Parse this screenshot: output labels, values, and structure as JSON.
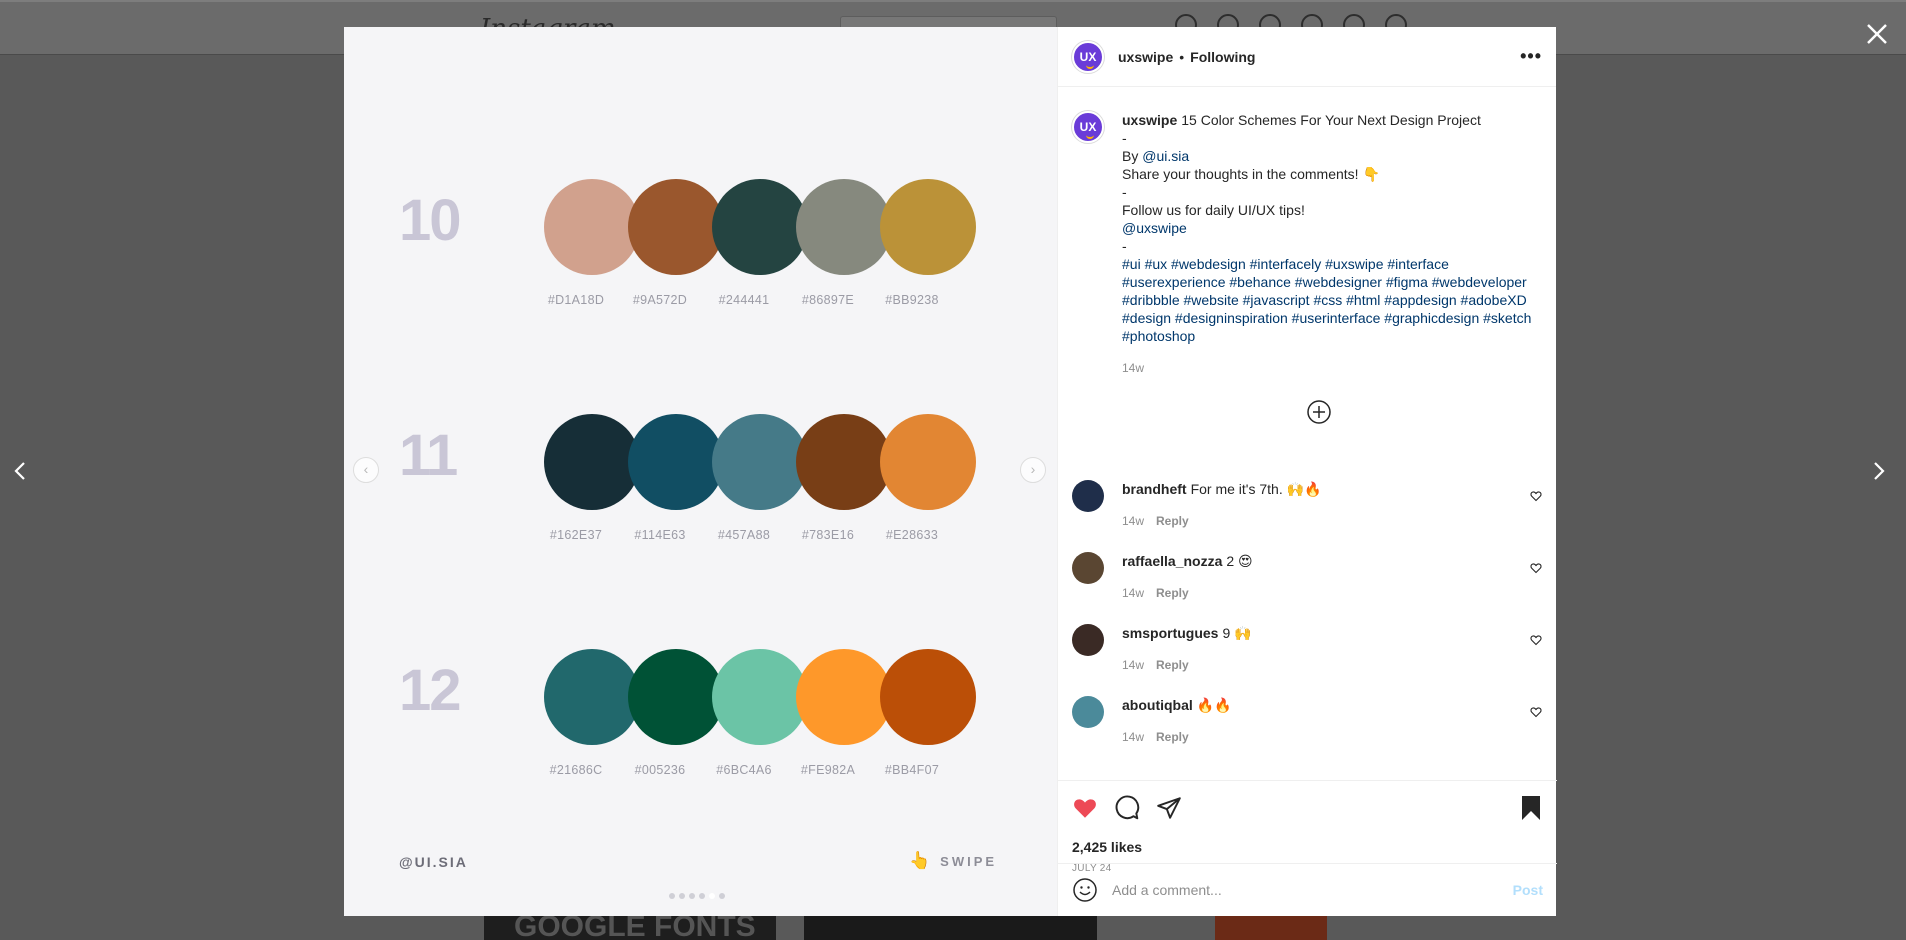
{
  "background": {
    "logo": "Instagram",
    "thumb_text": "GOOGLE FONTS"
  },
  "post": {
    "user": "uxswipe",
    "avatar_text": "UX",
    "follow_status": "Following",
    "header_dot": "•",
    "more_label": "•••"
  },
  "caption": {
    "user": "uxswipe",
    "title": "15 Color Schemes For Your Next Design Project",
    "dash1": "-",
    "by_prefix": "By ",
    "by_handle": "@ui.sia",
    "share_line": "Share your thoughts in the comments! 👇",
    "dash2": "-",
    "follow_line": "Follow us for daily UI/UX tips!",
    "mention": "@uxswipe",
    "dash3": "-",
    "hashtags": "#ui #ux #webdesign #interfacely #uxswipe #interface #userexperience #behance #webdesigner #figma #webdeveloper #dribbble #website #javascript #css #html #appdesign #adobeXD #design #designinspiration #userinterface #graphicdesign #sketch #photoshop",
    "time": "14w"
  },
  "comments": [
    {
      "user": "brandheft",
      "text": "For me it's 7th. 🙌🔥",
      "time": "14w",
      "reply": "Reply",
      "avatar_color": "#1f2e4a"
    },
    {
      "user": "raffaella_nozza",
      "text": "2 😍",
      "time": "14w",
      "reply": "Reply",
      "avatar_color": "#5a4632"
    },
    {
      "user": "smsportugues",
      "text": "9 🙌",
      "time": "14w",
      "reply": "Reply",
      "avatar_color": "#3a2a25"
    },
    {
      "user": "aboutiqbal",
      "text": "🔥🔥",
      "time": "14w",
      "reply": "Reply",
      "avatar_color": "#4b8a9a"
    }
  ],
  "engagement": {
    "likes": "2,425 likes",
    "date": "JULY 24"
  },
  "composer": {
    "placeholder": "Add a comment...",
    "post_label": "Post"
  },
  "media": {
    "credit": "@UI.SIA",
    "swipe_label": "SWIPE",
    "swipe_icon": "👆",
    "palettes": [
      {
        "number": "10",
        "colors": [
          "#D1A18D",
          "#9A572D",
          "#244441",
          "#86897E",
          "#BB9238"
        ],
        "labels": [
          "#D1A18D",
          "#9A572D",
          "#244441",
          "#86897E",
          "#BB9238"
        ]
      },
      {
        "number": "11",
        "colors": [
          "#162E37",
          "#114E63",
          "#457A88",
          "#783E16",
          "#E28633"
        ],
        "labels": [
          "#162E37",
          "#114E63",
          "#457A88",
          "#783E16",
          "#E28633"
        ]
      },
      {
        "number": "12",
        "colors": [
          "#21686C",
          "#005236",
          "#6BC4A6",
          "#FE982A",
          "#BB4F07"
        ],
        "labels": [
          "#21686C",
          "#005236",
          "#6BC4A6",
          "#FE982A",
          "#BB4F07"
        ]
      }
    ],
    "dots_count": 6,
    "active_dot": 4
  },
  "colors": {
    "like_red": "#ed4956",
    "link_blue": "#00376b",
    "avatar_purple": "#6a3bd8"
  }
}
